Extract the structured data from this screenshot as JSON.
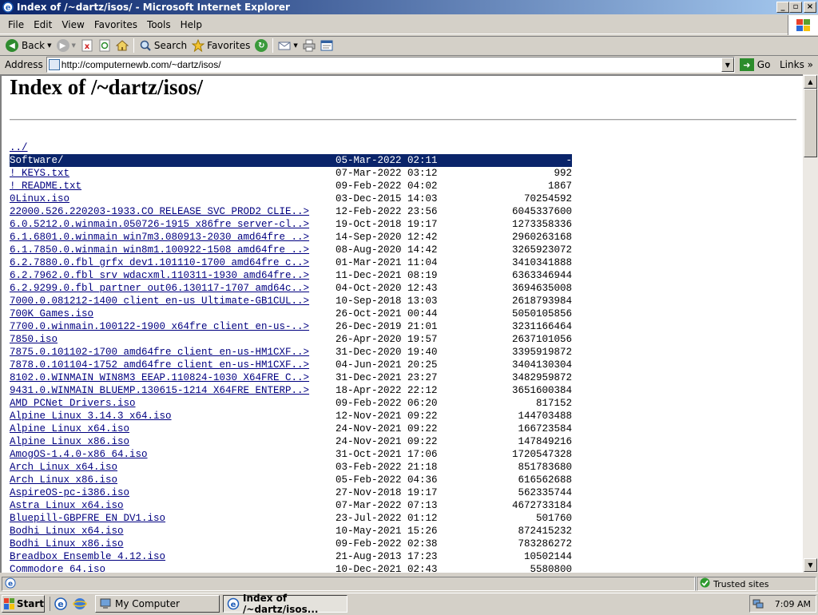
{
  "window": {
    "title": "Index of /~dartz/isos/ - Microsoft Internet Explorer",
    "min": "_",
    "max": "▫",
    "close": "×"
  },
  "menu": [
    "File",
    "Edit",
    "View",
    "Favorites",
    "Tools",
    "Help"
  ],
  "toolbar": {
    "back": "Back",
    "search": "Search",
    "favorites": "Favorites"
  },
  "address": {
    "label": "Address",
    "url": "http://computernewb.com/~dartz/isos/",
    "go": "Go",
    "links": "Links"
  },
  "page": {
    "title": "Index of /~dartz/isos/",
    "entries": [
      {
        "name": "../",
        "date": "",
        "size": ""
      },
      {
        "name": "Software/",
        "date": "05-Mar-2022 02:11",
        "size": "-"
      },
      {
        "name": "! KEYS.txt",
        "date": "07-Mar-2022 03:12",
        "size": "992"
      },
      {
        "name": "! README.txt",
        "date": "09-Feb-2022 04:02",
        "size": "1867"
      },
      {
        "name": "0Linux.iso",
        "date": "03-Dec-2015 14:03",
        "size": "70254592"
      },
      {
        "name": "22000.526.220203-1933.CO_RELEASE_SVC_PROD2_CLIE..>",
        "date": "12-Feb-2022 23:56",
        "size": "6045337600"
      },
      {
        "name": "6.0.5212.0.winmain.050726-1915_x86fre_server-cl..>",
        "date": "19-Oct-2018 19:17",
        "size": "1273358336"
      },
      {
        "name": "6.1.6801.0.winmain_win7m3.080913-2030_amd64fre_..>",
        "date": "14-Sep-2020 12:42",
        "size": "2960263168"
      },
      {
        "name": "6.1.7850.0.winmain_win8m1.100922-1508_amd64fre_..>",
        "date": "08-Aug-2020 14:42",
        "size": "3265923072"
      },
      {
        "name": "6.2.7880.0.fbl_grfx_dev1.101110-1700_amd64fre_c..>",
        "date": "01-Mar-2021 11:04",
        "size": "3410341888"
      },
      {
        "name": "6.2.7962.0.fbl_srv_wdacxml.110311-1930_amd64fre..>",
        "date": "11-Dec-2021 08:19",
        "size": "6363346944"
      },
      {
        "name": "6.2.9299.0.fbl_partner_out06.130117-1707_amd64c..>",
        "date": "04-Oct-2020 12:43",
        "size": "3694635008"
      },
      {
        "name": "7000.0.081212-1400_client_en-us_Ultimate-GB1CUL..>",
        "date": "10-Sep-2018 13:03",
        "size": "2618793984"
      },
      {
        "name": "700K Games.iso",
        "date": "26-Oct-2021 00:44",
        "size": "5050105856"
      },
      {
        "name": "7700.0.winmain.100122-1900_x64fre_client_en-us-..>",
        "date": "26-Dec-2019 21:01",
        "size": "3231166464"
      },
      {
        "name": "7850.iso",
        "date": "26-Apr-2020 19:57",
        "size": "2637101056"
      },
      {
        "name": "7875.0.101102-1700_amd64fre_client_en-us-HM1CXF..>",
        "date": "31-Dec-2020 19:40",
        "size": "3395919872"
      },
      {
        "name": "7878.0.101104-1752_amd64fre_client_en-us-HM1CXF..>",
        "date": "04-Jun-2021 20:25",
        "size": "3404130304"
      },
      {
        "name": "8102.0.WINMAIN_WIN8M3_EEAP.110824-1030_X64FRE_C..>",
        "date": "31-Dec-2021 23:27",
        "size": "3482959872"
      },
      {
        "name": "9431.0.WINMAIN_BLUEMP.130615-1214_X64FRE_ENTERP..>",
        "date": "18-Apr-2022 22:12",
        "size": "3651600384"
      },
      {
        "name": "AMD PCNet Drivers.iso",
        "date": "09-Feb-2022 06:20",
        "size": "817152"
      },
      {
        "name": "Alpine Linux 3.14.3 x64.iso",
        "date": "12-Nov-2021 09:22",
        "size": "144703488"
      },
      {
        "name": "Alpine Linux x64.iso",
        "date": "24-Nov-2021 09:22",
        "size": "166723584"
      },
      {
        "name": "Alpine Linux x86.iso",
        "date": "24-Nov-2021 09:22",
        "size": "147849216"
      },
      {
        "name": "AmogOS-1.4.0-x86_64.iso",
        "date": "31-Oct-2021 17:06",
        "size": "1720547328"
      },
      {
        "name": "Arch Linux x64.iso",
        "date": "03-Feb-2022 21:18",
        "size": "851783680"
      },
      {
        "name": "Arch Linux x86.iso",
        "date": "05-Feb-2022 04:36",
        "size": "616562688"
      },
      {
        "name": "AspireOS-pc-i386.iso",
        "date": "27-Nov-2018 19:17",
        "size": "562335744"
      },
      {
        "name": "Astra Linux x64.iso",
        "date": "07-Mar-2022 07:13",
        "size": "4672733184"
      },
      {
        "name": "Bluepill-GBPFRE_EN_DV1.iso",
        "date": "23-Jul-2022 01:12",
        "size": "501760"
      },
      {
        "name": "Bodhi Linux x64.iso",
        "date": "10-May-2021 15:26",
        "size": "872415232"
      },
      {
        "name": "Bodhi Linux x86.iso",
        "date": "09-Feb-2022 02:38",
        "size": "783286272"
      },
      {
        "name": "Breadbox Ensemble 4.12.iso",
        "date": "21-Aug-2013 17:23",
        "size": "10502144"
      },
      {
        "name": "Commodore 64.iso",
        "date": "10-Dec-2021 02:43",
        "size": "5580800"
      }
    ]
  },
  "status": {
    "zone": "Trusted sites"
  },
  "taskbar": {
    "start": "Start",
    "tasks": [
      "My Computer",
      "Index of /~dartz/isos..."
    ],
    "clock": "7:09 AM"
  },
  "colors": {
    "selection": "#0a246a",
    "link": "#000080"
  }
}
